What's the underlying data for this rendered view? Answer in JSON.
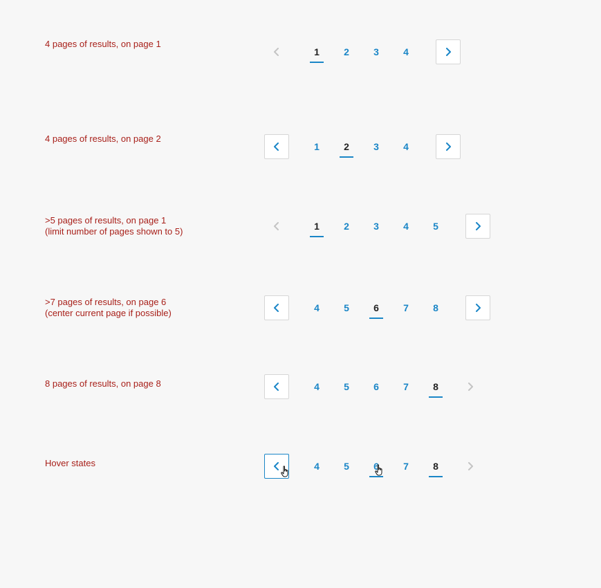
{
  "rows": [
    {
      "desc_line1": "4 pages of results, on page 1",
      "desc_line2": "",
      "prev": "disabled",
      "next": "enabled",
      "pages": [
        "1",
        "2",
        "3",
        "4"
      ],
      "current": "1"
    },
    {
      "desc_line1": "4 pages of results, on page 2",
      "desc_line2": "",
      "prev": "enabled",
      "next": "enabled",
      "pages": [
        "1",
        "2",
        "3",
        "4"
      ],
      "current": "2"
    },
    {
      "desc_line1": ">5 pages of results, on page 1",
      "desc_line2": "(limit number of pages shown to 5)",
      "prev": "disabled",
      "next": "enabled",
      "pages": [
        "1",
        "2",
        "3",
        "4",
        "5"
      ],
      "current": "1"
    },
    {
      "desc_line1": ">7 pages of results, on page 6",
      "desc_line2": "(center current page if possible)",
      "prev": "enabled",
      "next": "enabled",
      "pages": [
        "4",
        "5",
        "6",
        "7",
        "8"
      ],
      "current": "6"
    },
    {
      "desc_line1": "8 pages of results, on page 8",
      "desc_line2": "",
      "prev": "enabled",
      "next": "disabled",
      "pages": [
        "4",
        "5",
        "6",
        "7",
        "8"
      ],
      "current": "8"
    },
    {
      "desc_line1": "Hover states",
      "desc_line2": "",
      "prev": "hover",
      "next": "disabled",
      "pages": [
        "4",
        "5",
        "6",
        "7",
        "8"
      ],
      "current": "8",
      "hovered": "6"
    }
  ],
  "colors": {
    "background": "#f7f7f7",
    "description": "#a8201a",
    "link": "#1a86c7",
    "current": "#222222",
    "border": "#d6d6d6",
    "disabled": "#c4c4c4"
  },
  "icons": {
    "prev": "chevron-left-icon",
    "next": "chevron-right-icon",
    "cursor": "hand-pointer-icon"
  }
}
